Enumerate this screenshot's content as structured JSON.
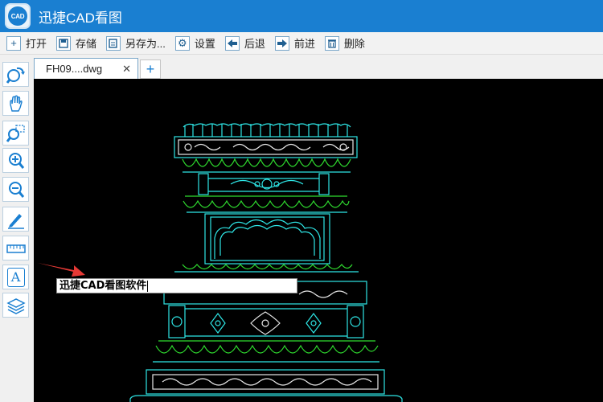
{
  "app": {
    "logo_text": "CAD",
    "title": "迅捷CAD看图"
  },
  "toolbar": {
    "open": "打开",
    "save": "存储",
    "save_as": "另存为...",
    "settings": "设置",
    "back": "后退",
    "forward": "前进",
    "delete": "删除"
  },
  "tabs": {
    "active_label": "FH09....dwg",
    "close_glyph": "✕",
    "new_glyph": "+"
  },
  "sidebar": {
    "tools": [
      "undo-zoom-icon",
      "pan-hand-icon",
      "zoom-window-icon",
      "zoom-in-icon",
      "zoom-out-icon",
      "annotate-pen-icon",
      "measure-ruler-icon",
      "text-tool-icon",
      "layers-icon"
    ],
    "text_tool_glyph": "A"
  },
  "editor": {
    "text_value": "迅捷CAD看图软件"
  },
  "colors": {
    "accent": "#1a7fd1",
    "drawing_cyan": "#2ee6e6",
    "drawing_green": "#2fdc2f",
    "arrow_red": "#e53935"
  }
}
